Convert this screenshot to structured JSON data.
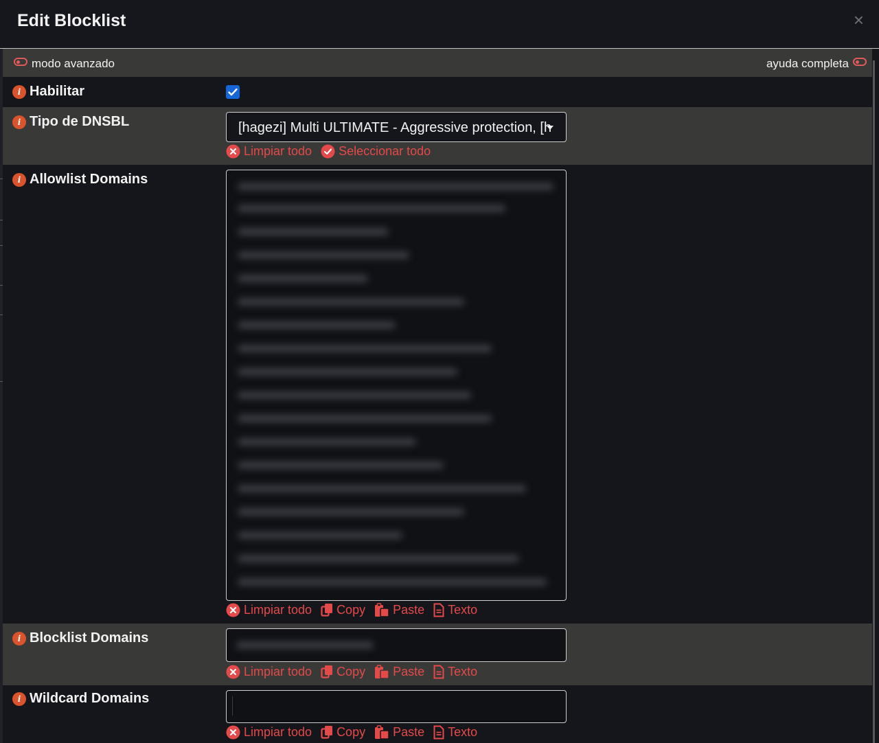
{
  "dialog": {
    "title": "Edit Blocklist",
    "close_symbol": "×"
  },
  "toolbar": {
    "advanced_mode_label": "modo avanzado",
    "full_help_label": "ayuda completa"
  },
  "fields": {
    "enabled": {
      "label": "Habilitar",
      "checked": true
    },
    "dnsbl_type": {
      "label": "Tipo de DNSBL",
      "selected_value": "[hagezi] Multi ULTIMATE - Aggressive protection, [h",
      "clear_all": "Limpiar todo",
      "select_all": "Seleccionar todo"
    },
    "allowlist": {
      "label": "Allowlist Domains",
      "clear_all": "Limpiar todo",
      "copy": "Copy",
      "paste": "Paste",
      "text": "Texto"
    },
    "blocklist": {
      "label": "Blocklist Domains",
      "clear_all": "Limpiar todo",
      "copy": "Copy",
      "paste": "Paste",
      "text": "Texto"
    },
    "wildcard": {
      "label": "Wildcard Domains",
      "clear_all": "Limpiar todo",
      "copy": "Copy",
      "paste": "Paste",
      "text": "Texto"
    }
  },
  "colors": {
    "accent_red": "#e44a4a",
    "info_orange": "#d9532c",
    "checkbox_blue": "#1666d8",
    "row_gray": "#393937",
    "background": "#15161b"
  }
}
